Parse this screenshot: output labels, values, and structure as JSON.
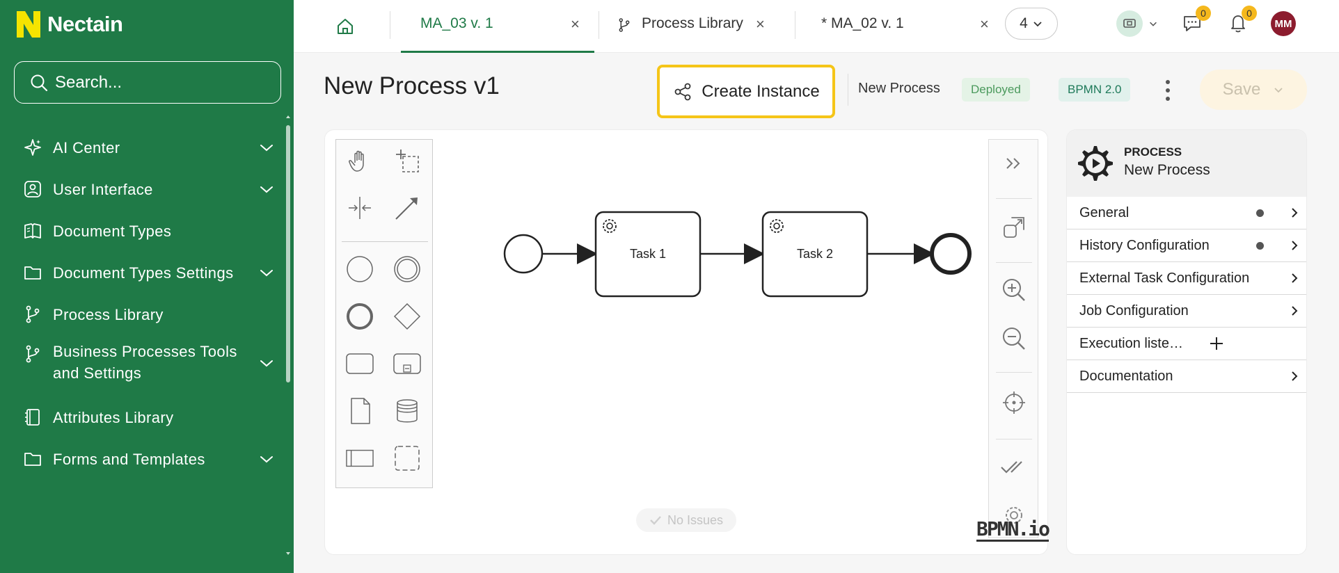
{
  "app": {
    "name": "Nectain",
    "brand_color": "#1f7a47",
    "accent_yellow": "#f5c518"
  },
  "search": {
    "placeholder": "Search..."
  },
  "sidebar": {
    "items": [
      {
        "label": "AI Center",
        "icon": "sparkle-icon",
        "expandable": true
      },
      {
        "label": "User Interface",
        "icon": "user-interface-icon",
        "expandable": true
      },
      {
        "label": "Document Types",
        "icon": "book-icon",
        "expandable": false
      },
      {
        "label": "Document Types Settings",
        "icon": "folder-icon",
        "expandable": true
      },
      {
        "label": "Process Library",
        "icon": "branch-icon",
        "expandable": false
      },
      {
        "label": "Business Processes Tools and Settings",
        "icon": "branch-icon",
        "expandable": true
      },
      {
        "label": "Attributes Library",
        "icon": "notebook-icon",
        "expandable": false
      },
      {
        "label": "Forms and Templates",
        "icon": "folder-icon",
        "expandable": true
      }
    ]
  },
  "tabs": [
    {
      "label": "MA_03 v. 1",
      "active": true
    },
    {
      "label": "Process Library",
      "active": false
    },
    {
      "label": "* MA_02 v. 1",
      "active": false
    }
  ],
  "tab_close_glyph": "×",
  "hidden_tabs_count": "4",
  "notifications": {
    "chat_count": "0",
    "bell_count": "0"
  },
  "user": {
    "initials": "MM"
  },
  "header": {
    "title": "New Process v1",
    "create_instance_label": "Create Instance",
    "process_name": "New Process",
    "status": "Deployed",
    "notation": "BPMN 2.0",
    "save_label": "Save"
  },
  "diagram": {
    "tasks": [
      {
        "label": "Task 1"
      },
      {
        "label": "Task 2"
      }
    ],
    "status_label": "No Issues",
    "watermark": "BPMN.io"
  },
  "panel": {
    "kind": "PROCESS",
    "name": "New Process",
    "rows": [
      {
        "label": "General",
        "has_dot": true,
        "action": "chevron"
      },
      {
        "label": "History Configuration",
        "has_dot": true,
        "action": "chevron"
      },
      {
        "label": "External Task Configuration",
        "has_dot": false,
        "action": "chevron"
      },
      {
        "label": "Job Configuration",
        "has_dot": false,
        "action": "chevron"
      },
      {
        "label": "Execution liste…",
        "has_dot": false,
        "action": "plus"
      },
      {
        "label": "Documentation",
        "has_dot": false,
        "action": "chevron"
      }
    ]
  }
}
